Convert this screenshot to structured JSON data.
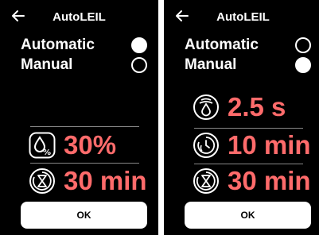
{
  "left": {
    "title": "AutoLEIL",
    "options": [
      {
        "label": "Automatic",
        "selected": true
      },
      {
        "label": "Manual",
        "selected": false
      }
    ],
    "rows": [
      {
        "icon": "humidity-percent-icon",
        "value": "30%"
      },
      {
        "icon": "hourglass-cycle-icon",
        "value": "30 min"
      }
    ],
    "ok_label": "OK"
  },
  "right": {
    "title": "AutoLEIL",
    "options": [
      {
        "label": "Automatic",
        "selected": false
      },
      {
        "label": "Manual",
        "selected": true
      }
    ],
    "rows": [
      {
        "icon": "spray-icon",
        "value": "2.5 s"
      },
      {
        "icon": "timer-cycle-icon",
        "value": "10 min"
      },
      {
        "icon": "hourglass-cycle-icon",
        "value": "30 min"
      }
    ],
    "ok_label": "OK"
  },
  "colors": {
    "accent": "#ff6b6b",
    "background": "#000000",
    "text": "#ffffff"
  }
}
